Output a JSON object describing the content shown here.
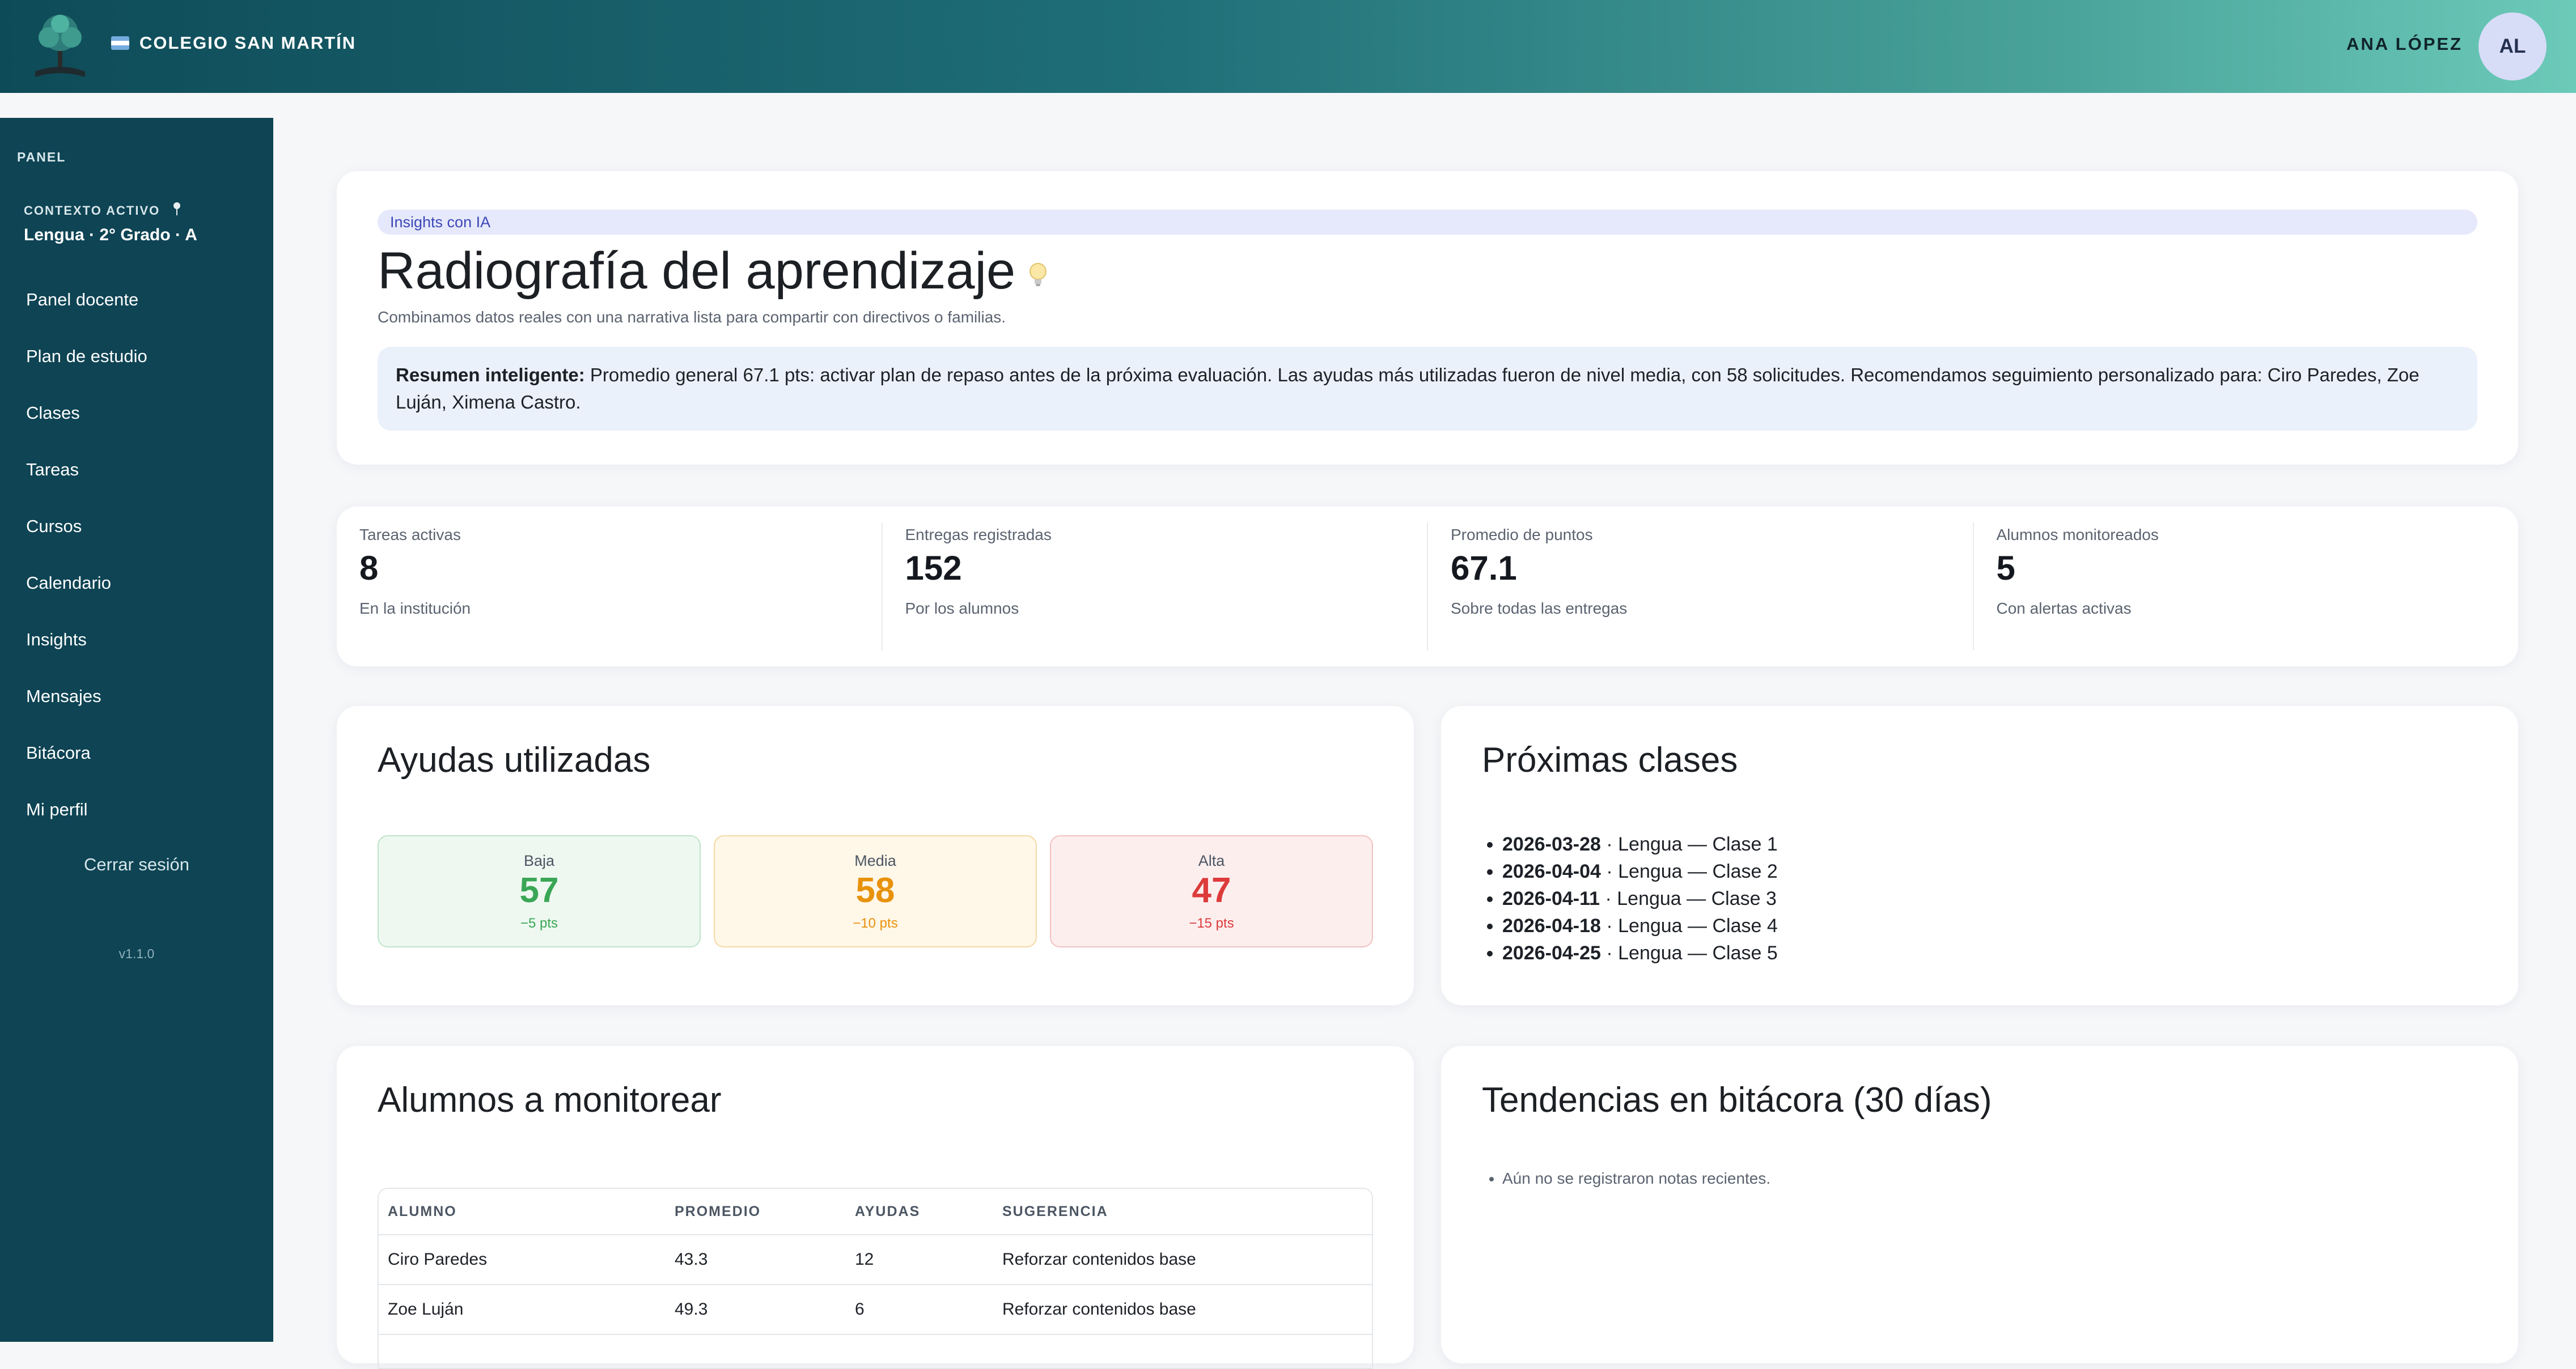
{
  "header": {
    "school_name": "COLEGIO SAN MARTÍN",
    "user_name": "ANA LÓPEZ",
    "user_initials": "AL"
  },
  "sidebar": {
    "panel_label": "PANEL",
    "context_label": "CONTEXTO ACTIVO",
    "context_value": "Lengua · 2° Grado · A",
    "items": [
      {
        "label": "Panel docente"
      },
      {
        "label": "Plan de estudio"
      },
      {
        "label": "Clases"
      },
      {
        "label": "Tareas"
      },
      {
        "label": "Cursos"
      },
      {
        "label": "Calendario"
      },
      {
        "label": "Insights"
      },
      {
        "label": "Mensajes"
      },
      {
        "label": "Bitácora"
      },
      {
        "label": "Mi perfil"
      }
    ],
    "logout_label": "Cerrar sesión",
    "version": "v1.1.0"
  },
  "hero": {
    "badge": "Insights con IA",
    "title": "Radiografía del aprendizaje",
    "subtitle": "Combinamos datos reales con una narrativa lista para compartir con directivos o familias.",
    "summary_label": "Resumen inteligente:",
    "summary_text": " Promedio general 67.1 pts: activar plan de repaso antes de la próxima evaluación. Las ayudas más utilizadas fueron de nivel media, con 58 solicitudes. Recomendamos seguimiento personalizado para: Ciro Paredes, Zoe Luján, Ximena Castro."
  },
  "stats": [
    {
      "label": "Tareas activas",
      "value": "8",
      "foot": "En la institución"
    },
    {
      "label": "Entregas registradas",
      "value": "152",
      "foot": "Por los alumnos"
    },
    {
      "label": "Promedio de puntos",
      "value": "67.1",
      "foot": "Sobre todas las entregas"
    },
    {
      "label": "Alumnos monitoreados",
      "value": "5",
      "foot": "Con alertas activas"
    }
  ],
  "aids": {
    "title": "Ayudas utilizadas",
    "levels": [
      {
        "label": "Baja",
        "value": "57",
        "pts": "−5 pts",
        "color": "#3aa655",
        "bg": "#eef8f1",
        "border": "#bfe3c9"
      },
      {
        "label": "Media",
        "value": "58",
        "pts": "−10 pts",
        "color": "#e8920c",
        "bg": "#fff7e8",
        "border": "#f4d9a6"
      },
      {
        "label": "Alta",
        "value": "47",
        "pts": "−15 pts",
        "color": "#dd3b3b",
        "bg": "#fdeeee",
        "border": "#f2c1c1"
      }
    ]
  },
  "upcoming": {
    "title": "Próximas clases",
    "items": [
      {
        "date": "2026-03-28",
        "text": " · Lengua — Clase 1"
      },
      {
        "date": "2026-04-04",
        "text": " · Lengua — Clase 2"
      },
      {
        "date": "2026-04-11",
        "text": " · Lengua — Clase 3"
      },
      {
        "date": "2026-04-18",
        "text": " · Lengua — Clase 4"
      },
      {
        "date": "2026-04-25",
        "text": " · Lengua — Clase 5"
      }
    ]
  },
  "monitor": {
    "title": "Alumnos a monitorear",
    "columns": [
      "ALUMNO",
      "PROMEDIO",
      "AYUDAS",
      "SUGERENCIA"
    ],
    "rows": [
      [
        "Ciro Paredes",
        "43.3",
        "12",
        "Reforzar contenidos base"
      ],
      [
        "Zoe Luján",
        "49.3",
        "6",
        "Reforzar contenidos base"
      ],
      [
        "",
        "",
        "",
        ""
      ]
    ]
  },
  "trends": {
    "title": "Tendencias en bitácora (30 días)",
    "empty": "Aún no se registraron notas recientes."
  },
  "colors": {
    "sidebar": "#0e4454",
    "header_start": "#0e4b58",
    "header_end": "#6ccab9",
    "badge_text": "#3d46b8"
  }
}
